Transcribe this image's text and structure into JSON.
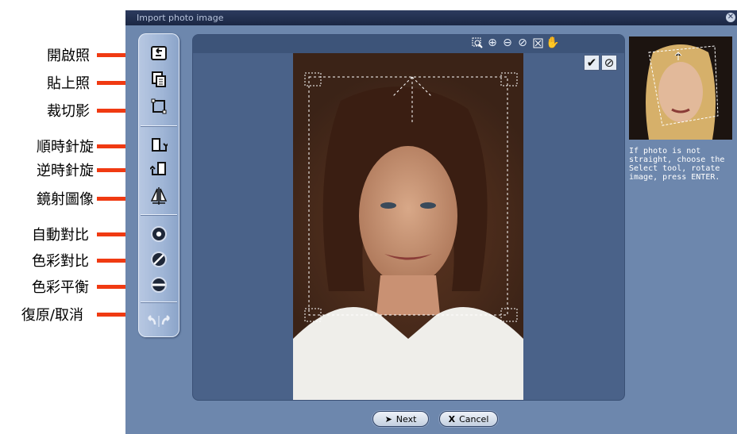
{
  "annotations": [
    {
      "label": "開啟照"
    },
    {
      "label": "貼上照"
    },
    {
      "label": "裁切影"
    },
    {
      "label": "順時針旋"
    },
    {
      "label": "逆時針旋"
    },
    {
      "label": "鏡射圖像"
    },
    {
      "label": "自動對比"
    },
    {
      "label": "色彩對比"
    },
    {
      "label": "色彩平衡"
    },
    {
      "label": "復原/取消"
    }
  ],
  "window": {
    "title": "Import photo image",
    "close_icon": "close-icon"
  },
  "toolbar": {
    "tools": [
      {
        "name": "open-icon"
      },
      {
        "name": "paste-icon"
      },
      {
        "name": "crop-icon"
      },
      {
        "name": "rotate-clockwise-icon"
      },
      {
        "name": "rotate-counterclockwise-icon"
      },
      {
        "name": "mirror-icon"
      },
      {
        "name": "auto-contrast-icon"
      },
      {
        "name": "color-contrast-icon"
      },
      {
        "name": "color-balance-icon"
      },
      {
        "name": "undo-redo-icon"
      }
    ]
  },
  "zoom_tools": [
    "zoom-select-icon",
    "zoom-in-icon",
    "zoom-out-icon",
    "zoom-reset-icon",
    "fit-icon",
    "hand-icon"
  ],
  "confirm": {
    "ok": "✔",
    "cancel": "⊘"
  },
  "info": {
    "text": "If photo is not straight, choose the Select tool, rotate image, press ENTER."
  },
  "buttons": {
    "next": "Next",
    "cancel": "Cancel",
    "next_glyph": "➤",
    "cancel_glyph": "X"
  },
  "colors": {
    "accent_arrow": "#f03a12",
    "window_bg": "#6d87ad",
    "titlebar": "#1b2744"
  }
}
